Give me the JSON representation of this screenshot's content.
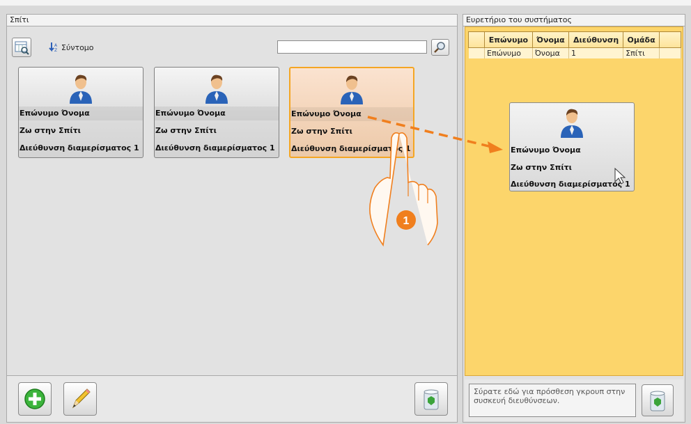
{
  "left_panel": {
    "title": "Σπίτι",
    "sort_label": "Σύντομο",
    "search_value": "",
    "cards": [
      {
        "line1": "Επώνυμο Όνομα",
        "line2": "Ζω στην  Σπίτι",
        "line3": "Διεύθυνση διαμερίσματος 1"
      },
      {
        "line1": "Επώνυμο Όνομα",
        "line2": "Ζω στην  Σπίτι",
        "line3": "Διεύθυνση διαμερίσματος 1"
      },
      {
        "line1": "Επώνυμο Όνομα",
        "line2": "Ζω στην  Σπίτι",
        "line3": "Διεύθυνση διαμερίσματος 1"
      }
    ]
  },
  "right_panel": {
    "title": "Ευρετήριο του συστήματος",
    "columns": [
      "Επώνυμο",
      "Όνομα",
      "Διεύθυνση",
      "Ομάδα"
    ],
    "row": [
      "Επώνυμο",
      "Όνομα",
      "1",
      "Σπίτι"
    ],
    "drag_card": {
      "line1": "Επώνυμο Όνομα",
      "line2": "Ζω στην  Σπίτι",
      "line3": "Διεύθυνση διαμερίσματος 1"
    },
    "drop_hint": "Σύρατε εδώ για πρόσθεση γκρουπ στην συσκευή διευθύνσεων."
  },
  "step_marker": "1",
  "colors": {
    "accent": "#f07f1e",
    "list_bg": "#fcd56b",
    "selected_border": "#f5a623"
  },
  "icons": [
    "view-icon",
    "sort-icon",
    "search-icon",
    "add-icon",
    "edit-icon",
    "trash-icon",
    "person-icon",
    "hand-pointer-icon"
  ]
}
